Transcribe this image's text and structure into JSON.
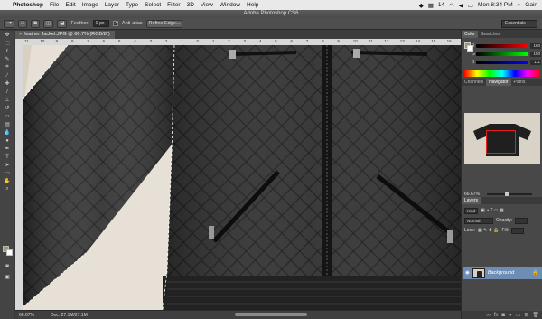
{
  "menubar": {
    "app_name": "Photoshop",
    "menus": [
      "File",
      "Edit",
      "Image",
      "Layer",
      "Type",
      "Select",
      "Filter",
      "3D",
      "View",
      "Window",
      "Help"
    ],
    "status_number": "14",
    "clock": "Mon 8:34 PM",
    "user": "Gain"
  },
  "window": {
    "title": "Adobe Photoshop CS6"
  },
  "options": {
    "feather_label": "Feather:",
    "feather_value": "0 px",
    "antialias_label": "Anti-alias",
    "refine_edge_label": "Refine Edge...",
    "workspace": "Essentials"
  },
  "document": {
    "tab_title": "leather Jacket.JPG @ 66.7% (RGB/8*)",
    "close_glyph": "×",
    "ruler_ticks": [
      "11",
      "10",
      "9",
      "8",
      "7",
      "6",
      "5",
      "4",
      "3",
      "2",
      "1",
      "0",
      "1",
      "2",
      "3",
      "4",
      "5",
      "6",
      "7",
      "8",
      "9",
      "10",
      "11",
      "12",
      "13",
      "14",
      "15",
      "16"
    ]
  },
  "status": {
    "zoom": "66.67%",
    "doc_info": "Doc: 27.1M/27.1M"
  },
  "color_panel": {
    "tabs": [
      "Color",
      "Swatches"
    ],
    "channels": [
      {
        "label": "R",
        "value": "160",
        "color": "#e04040"
      },
      {
        "label": "G",
        "value": "150",
        "color": "#40c040"
      },
      {
        "label": "B",
        "value": "111",
        "color": "#4060e0"
      }
    ]
  },
  "navigator_panel": {
    "tabs": [
      "Channels",
      "Navigator",
      "Paths"
    ],
    "zoom": "66.67%"
  },
  "layers_panel": {
    "title": "Layers",
    "kind_label": "Kind",
    "blend_mode": "Normal",
    "opacity_label": "Opacity:",
    "lock_label": "Lock:",
    "fill_label": "Fill:",
    "layer_name": "Background"
  },
  "colors": {
    "ui_dark": "#3a3a3a",
    "selection": "#6d8db5",
    "navigator_box": "#e02020",
    "jacket": "#2a2a2a",
    "backdrop": "#e7e0d6"
  }
}
